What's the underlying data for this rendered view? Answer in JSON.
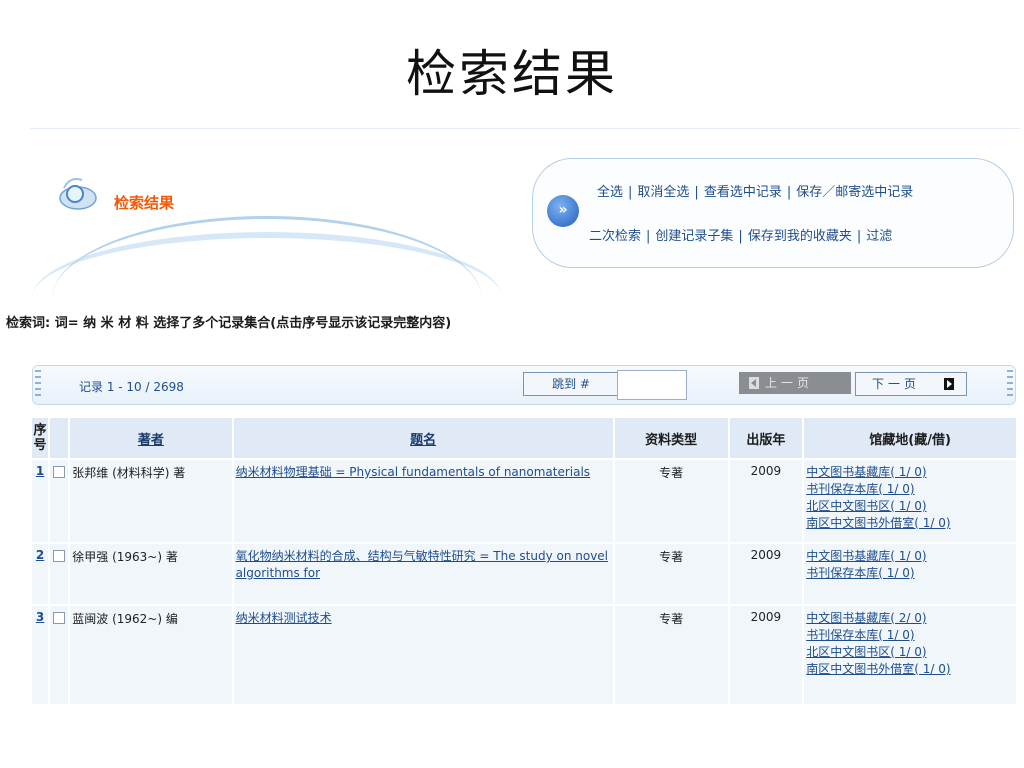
{
  "page_title": "检索结果",
  "banner": {
    "label": "检索结果"
  },
  "actions": {
    "row1": [
      "全选",
      "取消全选",
      "查看选中记录",
      "保存／邮寄选中记录"
    ],
    "row2": [
      "二次检索",
      "创建记录子集",
      "保存到我的收藏夹",
      "过滤"
    ]
  },
  "query_line": "检索词: 词= 纳 米 材 料 选择了多个记录集合(点击序号显示该记录完整内容)",
  "pager": {
    "range": "记录 1 - 10 / 2698",
    "goto": "跳到 #",
    "goto_value": "",
    "prev": "上一页",
    "next": "下一页"
  },
  "table": {
    "headers": {
      "seq": "序号",
      "author": "著者",
      "title": "题名",
      "type": "资料类型",
      "year": "出版年",
      "holdings": "馆藏地(藏/借)"
    },
    "rows": [
      {
        "no": "1",
        "author": "张邦维 (材料科学) 著",
        "title": "纳米材料物理基础 = Physical fundamentals of nanomaterials",
        "type": "专著",
        "year": "2009",
        "holdings": [
          "中文图书基藏库( 1/ 0)",
          "书刊保存本库( 1/ 0)",
          "北区中文图书区( 1/ 0)",
          "南区中文图书外借室( 1/ 0)"
        ]
      },
      {
        "no": "2",
        "author": "徐甲强 (1963~) 著",
        "title": "氧化物纳米材料的合成、结构与气敏特性研究 = The study on novel algorithms for",
        "type": "专著",
        "year": "2009",
        "holdings": [
          "中文图书基藏库( 1/ 0)",
          "书刊保存本库( 1/ 0)"
        ]
      },
      {
        "no": "3",
        "author": "蓝闽波 (1962~) 编",
        "title": "纳米材料测试技术",
        "type": "专著",
        "year": "2009",
        "holdings": [
          "中文图书基藏库( 2/ 0)",
          "书刊保存本库( 1/ 0)",
          "北区中文图书区( 1/ 0)",
          "南区中文图书外借室( 1/ 0)"
        ]
      }
    ]
  }
}
